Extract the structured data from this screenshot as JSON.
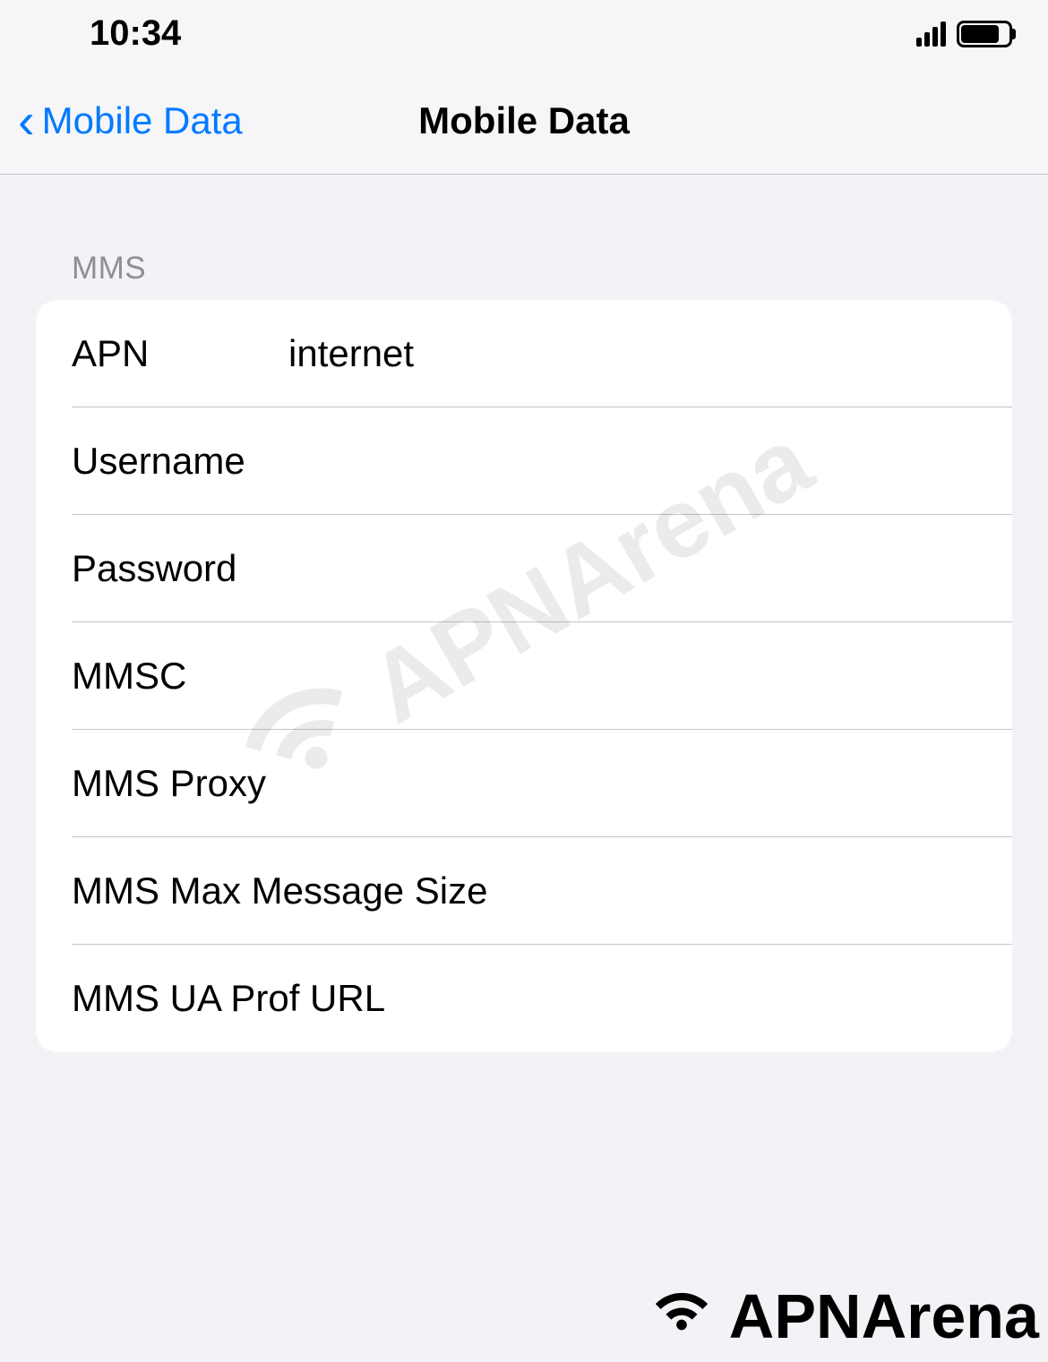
{
  "status_bar": {
    "time": "10:34"
  },
  "nav": {
    "back_label": "Mobile Data",
    "title": "Mobile Data"
  },
  "section": {
    "header": "MMS"
  },
  "fields": {
    "apn": {
      "label": "APN",
      "value": "internet"
    },
    "username": {
      "label": "Username",
      "value": ""
    },
    "password": {
      "label": "Password",
      "value": ""
    },
    "mmsc": {
      "label": "MMSC",
      "value": ""
    },
    "mms_proxy": {
      "label": "MMS Proxy",
      "value": ""
    },
    "mms_max_size": {
      "label": "MMS Max Message Size",
      "value": ""
    },
    "mms_ua_prof": {
      "label": "MMS UA Prof URL",
      "value": ""
    }
  },
  "watermark": {
    "text": "APNArena"
  },
  "footer": {
    "text": "APNArena"
  }
}
